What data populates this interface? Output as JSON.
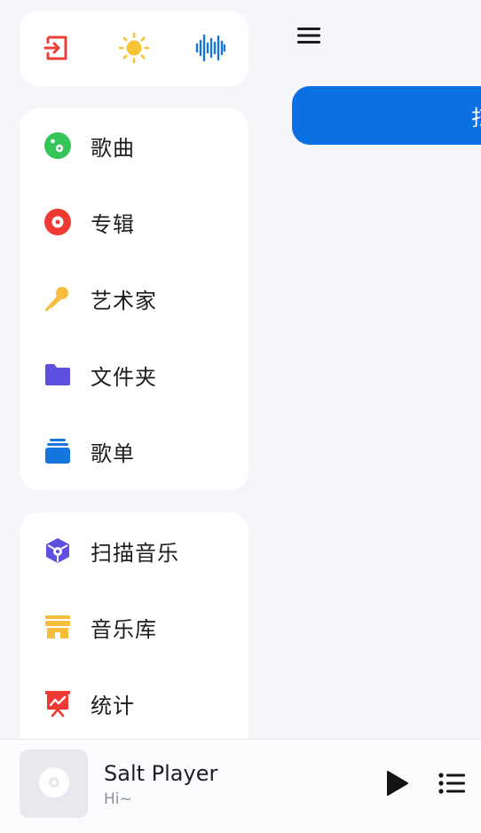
{
  "quick_actions": [
    {
      "icon": "exit-icon",
      "color": "#e8413a"
    },
    {
      "icon": "sun-icon",
      "color": "#f7c436"
    },
    {
      "icon": "waveform-icon",
      "color": "#1676e0"
    }
  ],
  "nav": {
    "items": [
      {
        "label": "歌曲",
        "icon": "music-note-icon",
        "color": "#33c45a"
      },
      {
        "label": "专辑",
        "icon": "album-disc-icon",
        "color": "#ef3a33"
      },
      {
        "label": "艺术家",
        "icon": "microphone-icon",
        "color": "#f7bd3a"
      },
      {
        "label": "文件夹",
        "icon": "folder-icon",
        "color": "#5d4fe0"
      },
      {
        "label": "歌单",
        "icon": "playlist-stack-icon",
        "color": "#1676e0"
      }
    ]
  },
  "tools": {
    "items": [
      {
        "label": "扫描音乐",
        "icon": "scan-cube-icon",
        "color": "#5d4fe0"
      },
      {
        "label": "音乐库",
        "icon": "library-shop-icon",
        "color": "#f7bd3a"
      },
      {
        "label": "统计",
        "icon": "stats-board-icon",
        "color": "#ef3a33"
      }
    ]
  },
  "main": {
    "scan_button_label": "扫"
  },
  "player": {
    "title": "Salt Player",
    "subtitle": "Hi~"
  }
}
